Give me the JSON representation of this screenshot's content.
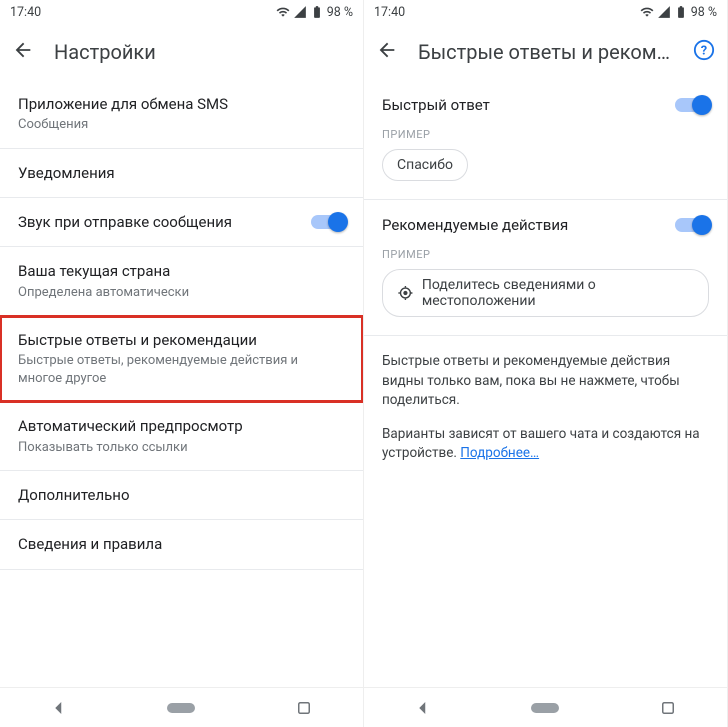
{
  "status": {
    "time": "17:40",
    "battery": "98 %"
  },
  "left": {
    "title": "Настройки",
    "items": [
      {
        "title": "Приложение для обмена SMS",
        "sub": "Сообщения"
      },
      {
        "title": "Уведомления",
        "sub": ""
      },
      {
        "title": "Звук при отправке сообщения",
        "sub": "",
        "toggle": true
      },
      {
        "title": "Ваша текущая страна",
        "sub": "Определена автоматически"
      },
      {
        "title": "Быстрые ответы и рекомендации",
        "sub": "Быстрые ответы, рекомендуемые действия и многое другое",
        "highlight": true
      },
      {
        "title": "Автоматический предпросмотр",
        "sub": "Показывать только ссылки"
      },
      {
        "title": "Дополнительно",
        "sub": ""
      },
      {
        "title": "Сведения и правила",
        "sub": ""
      }
    ]
  },
  "right": {
    "title": "Быстрые ответы и рекоменд…",
    "section1": {
      "title": "Быстрый ответ",
      "caption": "ПРИМЕР",
      "chip": "Спасибо"
    },
    "section2": {
      "title": "Рекомендуемые действия",
      "caption": "ПРИМЕР",
      "chip": "Поделитесь сведениями о местоположении"
    },
    "para1": "Быстрые ответы и рекомендуемые действия видны только вам, пока вы не нажмете, чтобы поделиться.",
    "para2": "Варианты зависят от вашего чата и создаются на устройстве. ",
    "link": "Подробнее…"
  }
}
